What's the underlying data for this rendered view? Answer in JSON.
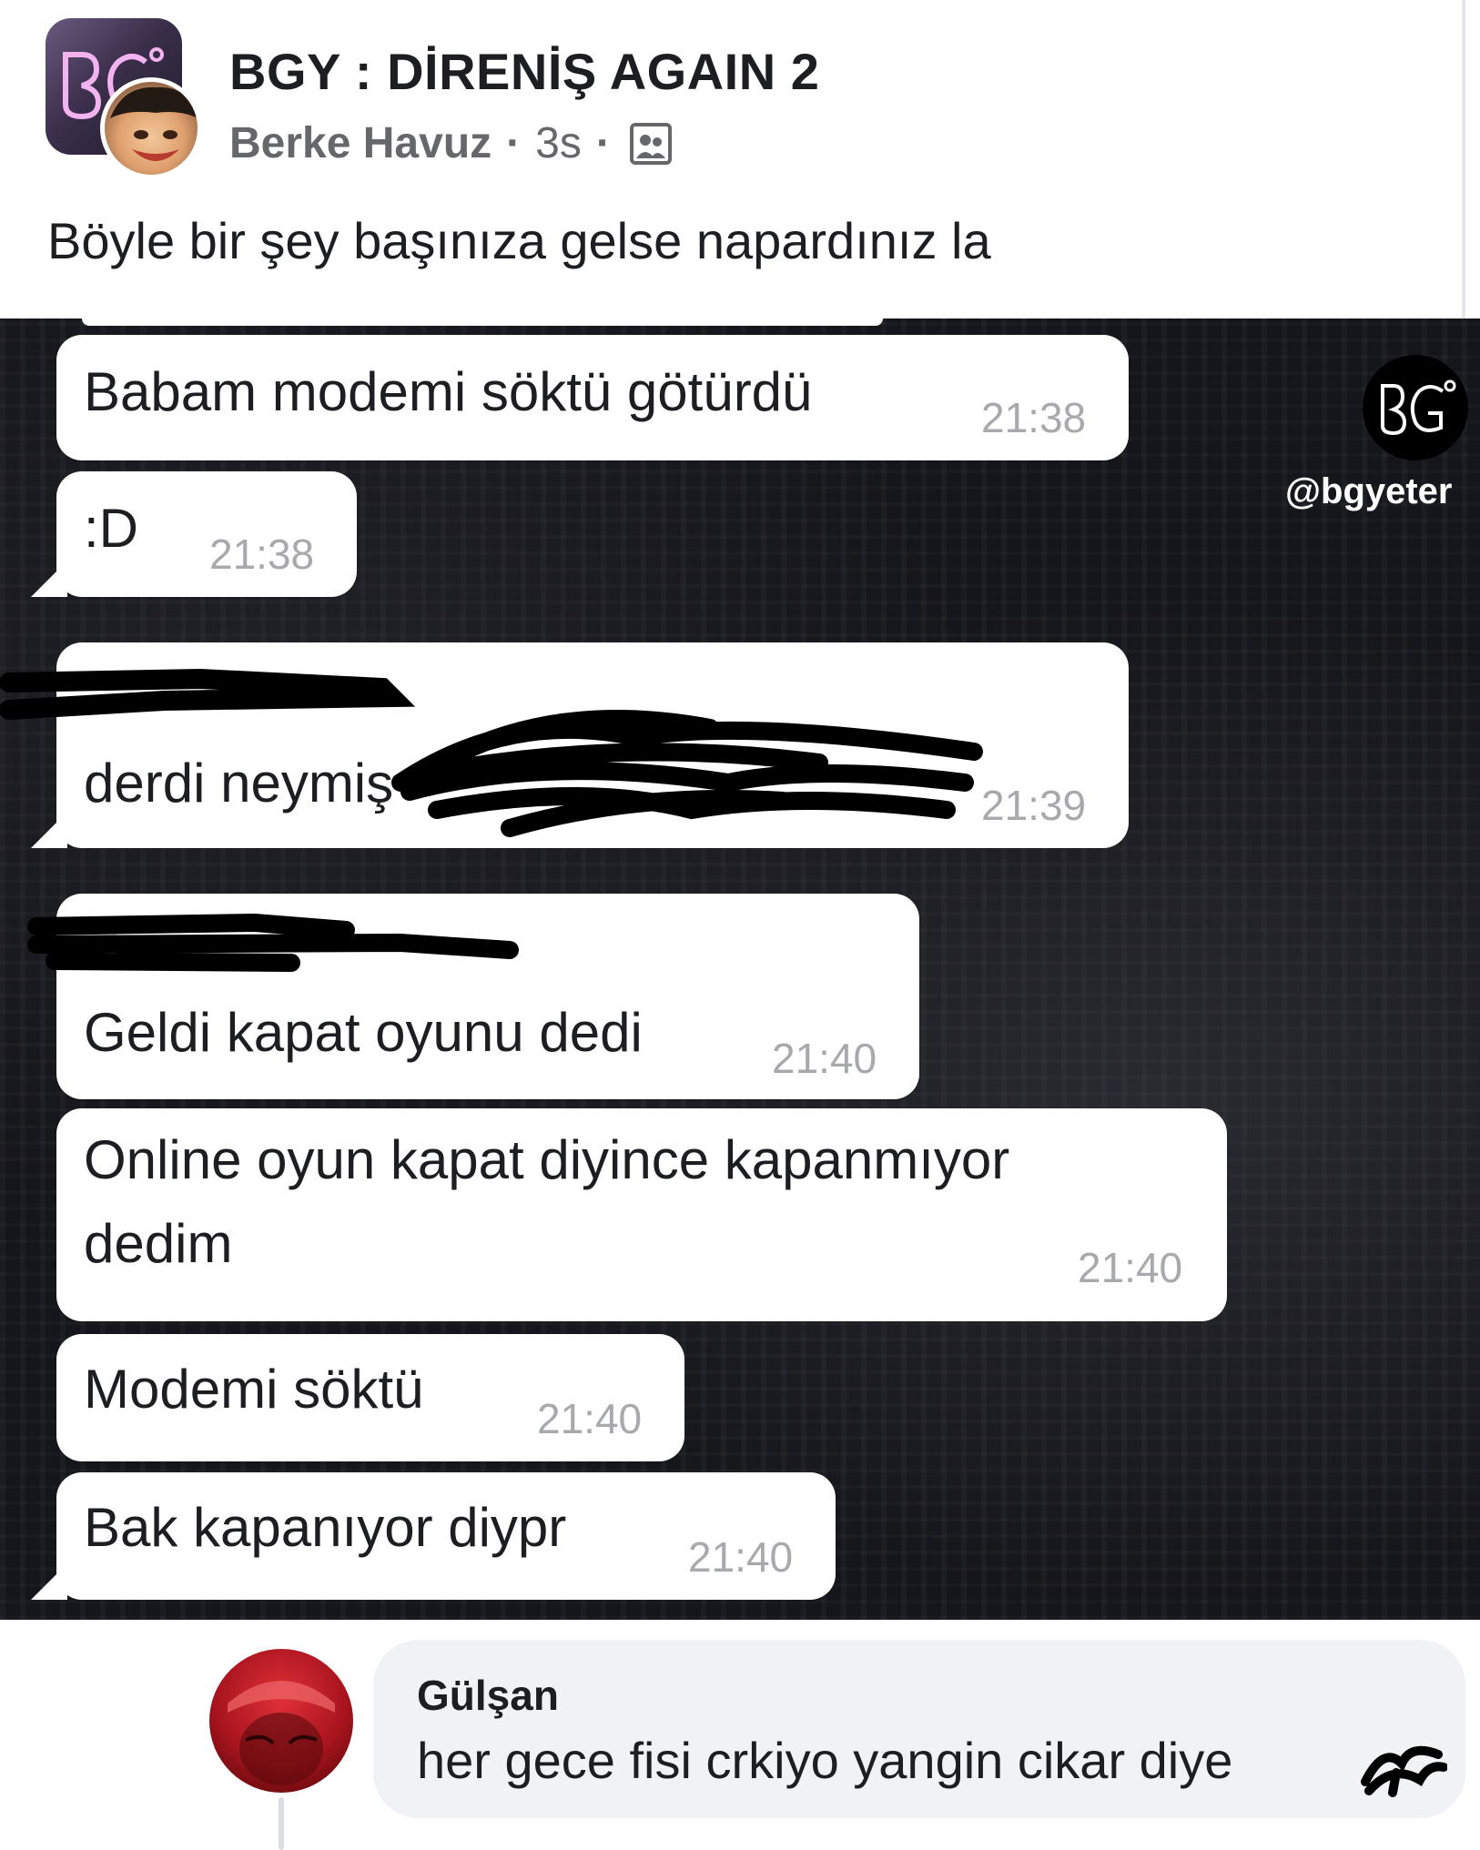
{
  "post": {
    "group_name": "BGY : DİRENİŞ AGAIN 2",
    "author": "Berke Havuz",
    "time": "3s",
    "separator": "·",
    "audience_icon": "group-members-icon",
    "text": "Böyle bir şey başınıza gelse napardınız la"
  },
  "chat_image": {
    "watermark_handle": "@bgyeter",
    "watermark_logo": "bgy-logo-icon",
    "messages": [
      {
        "text": "Babam modemi söktü götürdü",
        "time": "21:38"
      },
      {
        "text": ":D",
        "time": "21:38"
      },
      {
        "text": "derdi neymiş",
        "time": "21:39",
        "redacted": true
      },
      {
        "text": "Geldi kapat oyunu dedi",
        "time": "21:40",
        "redacted": true
      },
      {
        "text": "Online oyun kapat diyince kapanmıyor",
        "text2": "dedim",
        "time": "21:40"
      },
      {
        "text": "Modemi söktü",
        "time": "21:40"
      },
      {
        "text": "Bak kapanıyor diypr",
        "time": "21:40"
      }
    ]
  },
  "comment": {
    "name": "Gülşan",
    "text": "her gece fisi crkiyo yangin cikar diye"
  },
  "colors": {
    "chat_background": "#15161b",
    "bubble": "#ffffff",
    "timestamp": "#a7a9ad",
    "comment_bubble": "#f0f2f5",
    "meta_text": "#65676b"
  }
}
